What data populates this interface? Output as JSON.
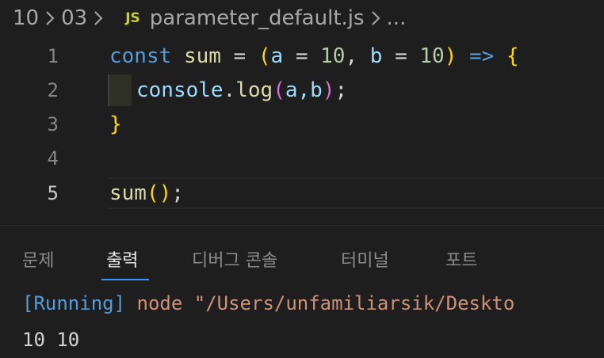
{
  "breadcrumb": {
    "items": [
      "10",
      "03"
    ],
    "file_icon": "JS",
    "file_name": "parameter_default.js",
    "more": "..."
  },
  "editor": {
    "lines": [
      {
        "number": "1"
      },
      {
        "number": "2"
      },
      {
        "number": "3"
      },
      {
        "number": "4"
      },
      {
        "number": "5"
      }
    ],
    "tokens": {
      "l1_const": "const",
      "l1_sum": "sum",
      "l1_eq": " = ",
      "l1_open": "(",
      "l1_a": "a",
      "l1_eq2": " = ",
      "l1_10a": "10",
      "l1_comma": ", ",
      "l1_b": "b",
      "l1_eq3": " = ",
      "l1_10b": "10",
      "l1_close": ")",
      "l1_arrow": " => ",
      "l1_brace": "{",
      "l2_console": "console",
      "l2_dot": ".",
      "l2_log": "log",
      "l2_open": "(",
      "l2_args": "a,b",
      "l2_close": ")",
      "l2_semi": ";",
      "l3_brace": "}",
      "l5_sum": "sum",
      "l5_parens": "()",
      "l5_semi": ";"
    },
    "active_line": "5"
  },
  "panel": {
    "tabs": [
      "문제",
      "출력",
      "디버그 콘솔",
      "터미널",
      "포트"
    ],
    "active_tab": "출력",
    "output_running": "[Running]",
    "output_command": " node \"/Users/unfamiliarsik/Deskto",
    "output_result": "10 10"
  },
  "colors": {
    "background": "#1e1e1e",
    "keyword": "#569cd6",
    "function": "#dcdcaa",
    "variable": "#9cdcfe",
    "number": "#b5cea8",
    "bracket": "#ffd700",
    "string": "#ce9178",
    "tab_active_underline": "#3794ff"
  },
  "icons": {
    "file_icon": "javascript-file-icon",
    "separator": "chevron-right-icon"
  }
}
